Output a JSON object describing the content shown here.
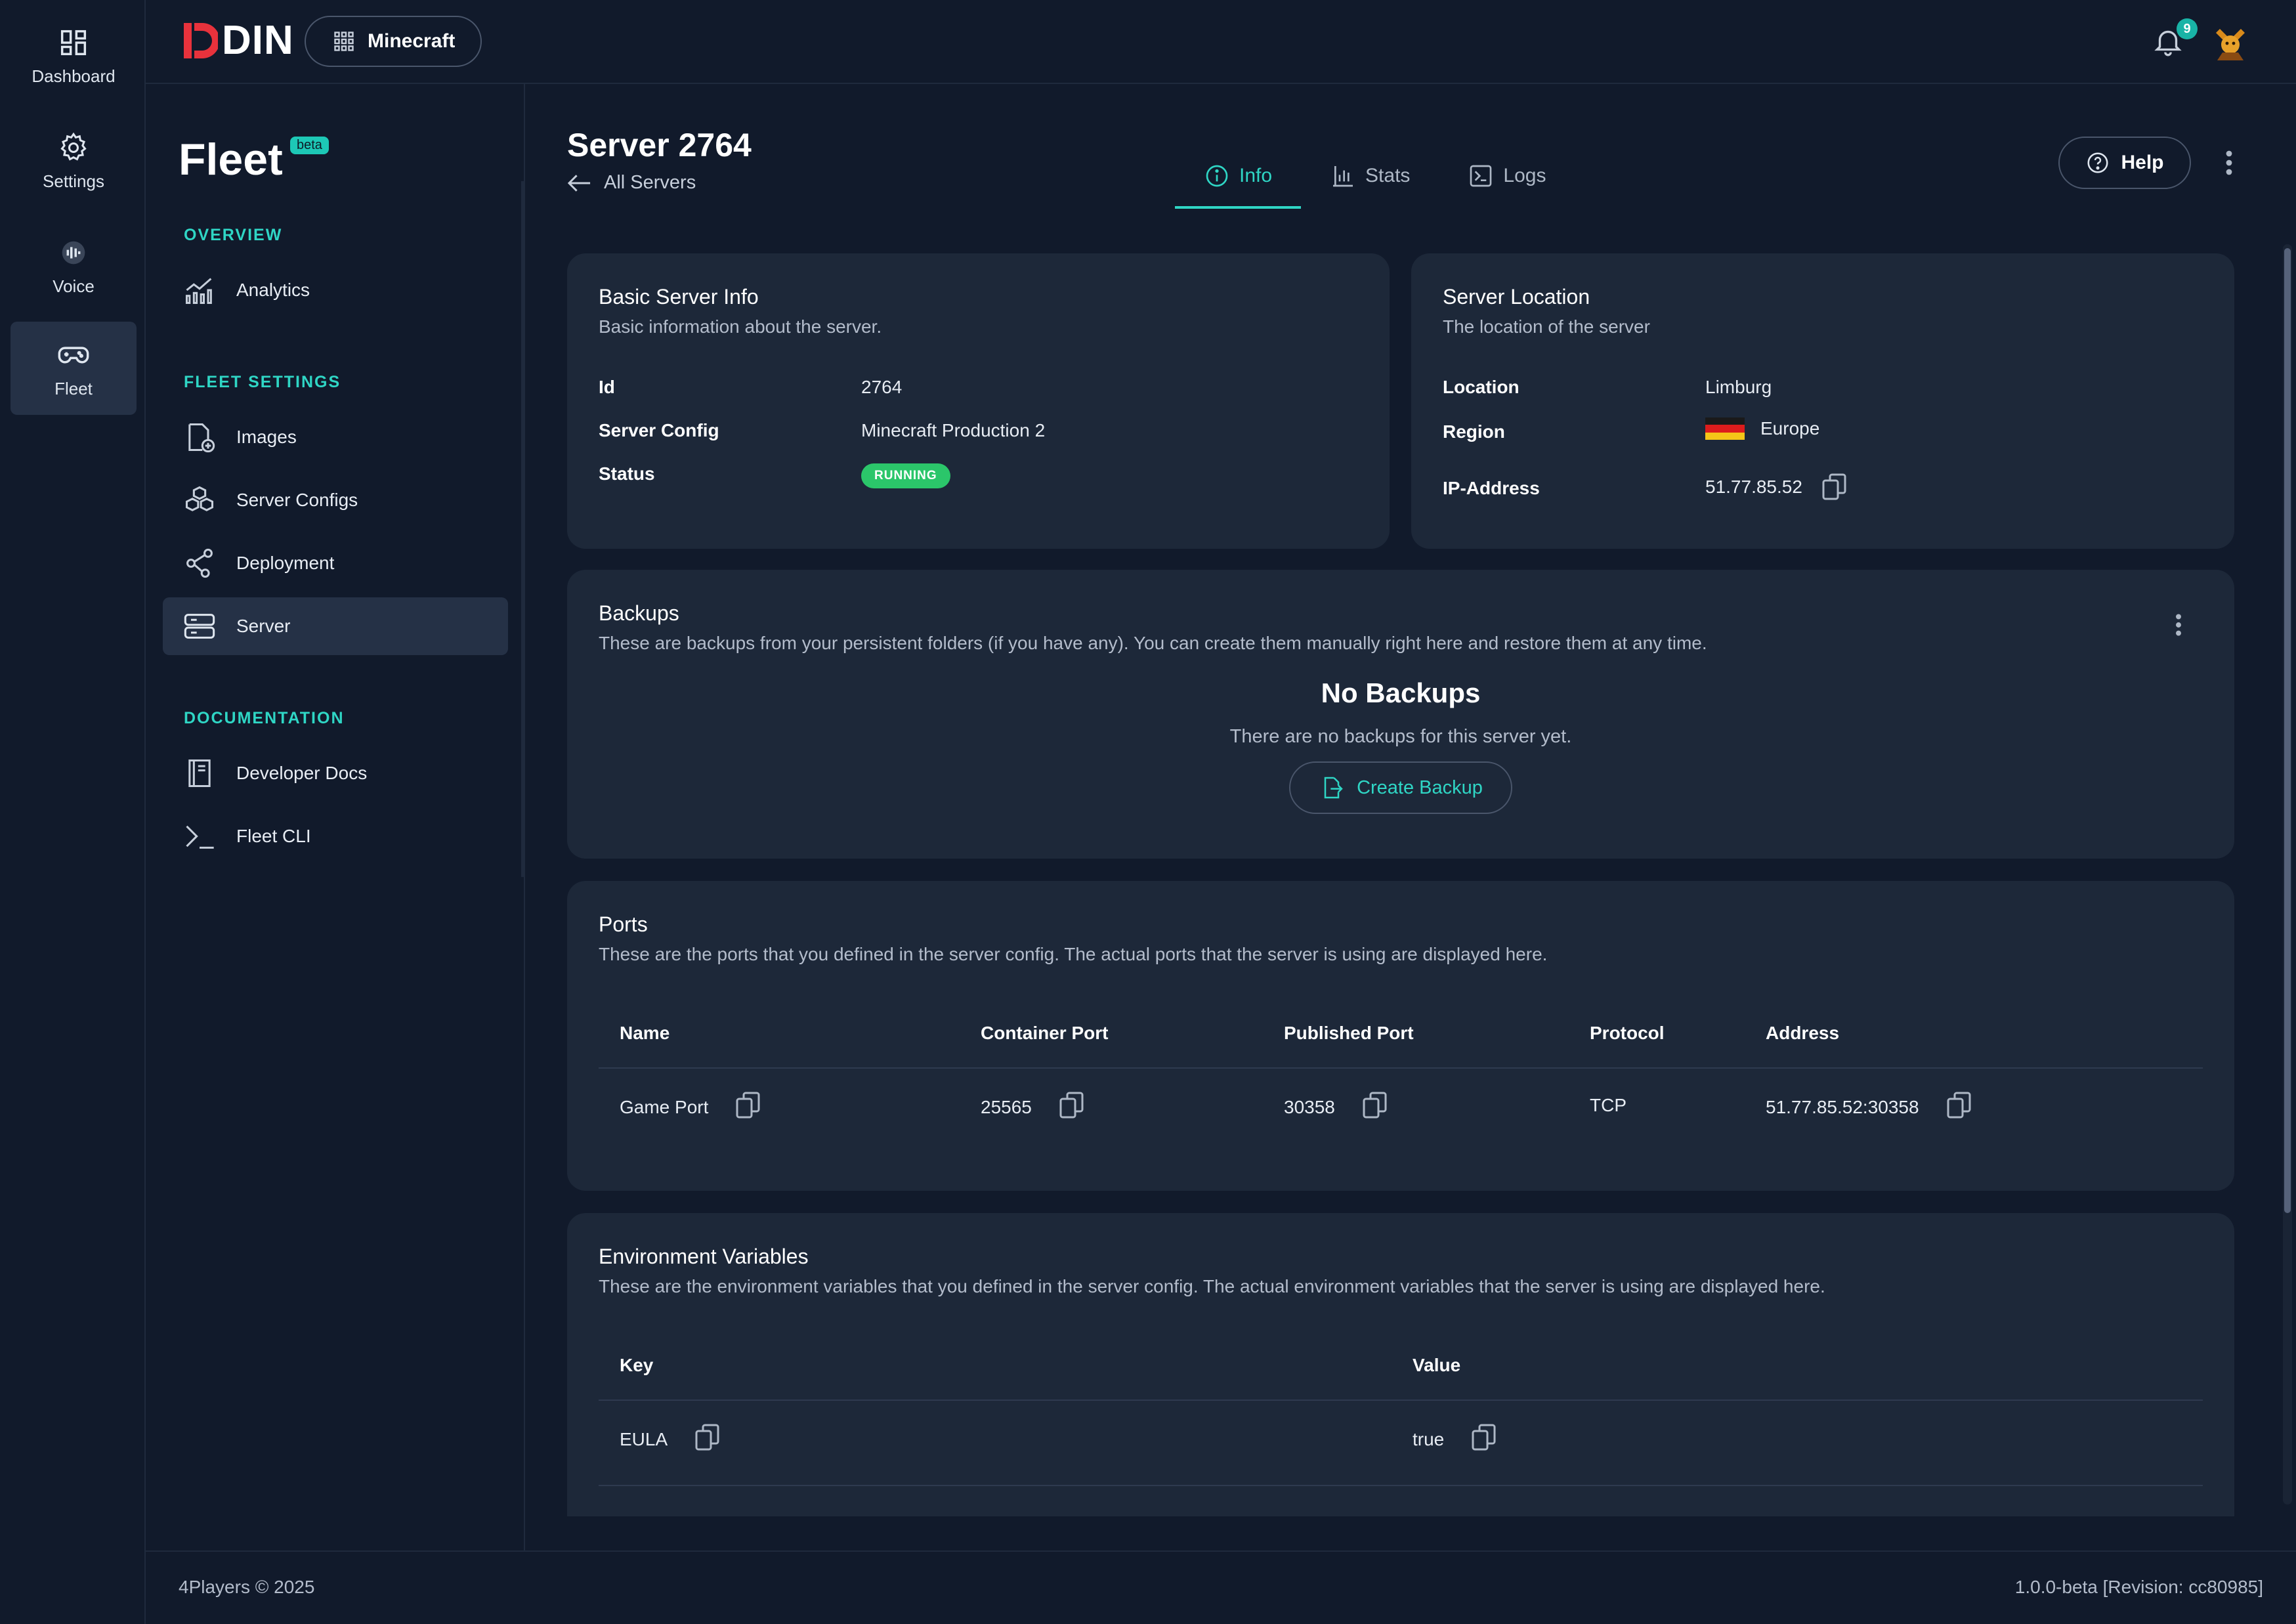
{
  "rail": {
    "items": [
      {
        "label": "Dashboard",
        "icon": "dashboard-icon"
      },
      {
        "label": "Settings",
        "icon": "gear-icon"
      },
      {
        "label": "Voice",
        "icon": "voice-icon"
      },
      {
        "label": "Fleet",
        "icon": "gamepad-icon",
        "active": true
      }
    ]
  },
  "topbar": {
    "logo_text": "DIN",
    "app_switch_label": "Minecraft",
    "notification_count": "9"
  },
  "fleetnav": {
    "title": "Fleet",
    "badge": "beta",
    "sections": [
      {
        "label": "OVERVIEW",
        "items": [
          {
            "label": "Analytics",
            "icon": "analytics-icon"
          }
        ]
      },
      {
        "label": "FLEET SETTINGS",
        "items": [
          {
            "label": "Images",
            "icon": "image-file-icon"
          },
          {
            "label": "Server Configs",
            "icon": "boxes-icon"
          },
          {
            "label": "Deployment",
            "icon": "share-nodes-icon"
          },
          {
            "label": "Server",
            "icon": "server-icon",
            "active": true
          }
        ]
      },
      {
        "label": "DOCUMENTATION",
        "items": [
          {
            "label": "Developer Docs",
            "icon": "book-icon"
          },
          {
            "label": "Fleet CLI",
            "icon": "terminal-icon"
          }
        ]
      }
    ]
  },
  "header": {
    "title": "Server 2764",
    "back_label": "All Servers",
    "tabs": [
      {
        "label": "Info",
        "icon": "info-icon",
        "active": true
      },
      {
        "label": "Stats",
        "icon": "bar-chart-icon"
      },
      {
        "label": "Logs",
        "icon": "terminal-box-icon"
      }
    ],
    "help_label": "Help"
  },
  "basic_info": {
    "title": "Basic Server Info",
    "subtitle": "Basic information about the server.",
    "rows": [
      {
        "key": "Id",
        "value": "2764"
      },
      {
        "key": "Server Config",
        "value": "Minecraft Production 2"
      },
      {
        "key": "Status",
        "value": "RUNNING"
      }
    ],
    "status_color": "#2bc66a"
  },
  "location": {
    "title": "Server Location",
    "subtitle": "The location of the server",
    "rows": [
      {
        "key": "Location",
        "value": "Limburg"
      },
      {
        "key": "Region",
        "value": "Europe"
      },
      {
        "key": "IP-Address",
        "value": "51.77.85.52"
      }
    ]
  },
  "backups": {
    "title": "Backups",
    "subtitle": "These are backups from your persistent folders (if you have any). You can create them manually right here and restore them at any time.",
    "empty_title": "No Backups",
    "empty_sub": "There are no backups for this server yet.",
    "create_label": "Create Backup"
  },
  "ports": {
    "title": "Ports",
    "subtitle": "These are the ports that you defined in the server config. The actual ports that the server is using are displayed here.",
    "columns": [
      "Name",
      "Container Port",
      "Published Port",
      "Protocol",
      "Address"
    ],
    "rows": [
      {
        "name": "Game Port",
        "container": "25565",
        "published": "30358",
        "protocol": "TCP",
        "address": "51.77.85.52:30358"
      }
    ]
  },
  "env": {
    "title": "Environment Variables",
    "subtitle": "These are the environment variables that you defined in the server config. The actual environment variables that the server is using are displayed here.",
    "columns": [
      "Key",
      "Value"
    ],
    "rows": [
      {
        "key": "EULA",
        "value": "true"
      }
    ]
  },
  "footer": {
    "copyright": "4Players © 2025",
    "version": "1.0.0-beta [Revision: cc80985]"
  },
  "colors": {
    "accent": "#2fd6c5",
    "background": "#111a2b",
    "card": "#1d2839",
    "running": "#2bc66a",
    "logo_red": "#e8323c"
  }
}
